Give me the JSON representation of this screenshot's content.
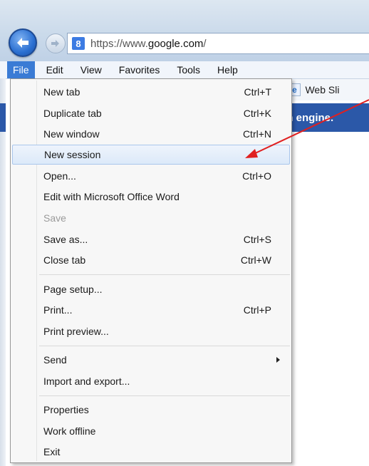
{
  "address_bar": {
    "url_scheme": "https://www.",
    "url_host": "google.com",
    "url_tail": "/",
    "favicon_letter": "8"
  },
  "menubar": [
    "File",
    "Edit",
    "View",
    "Favorites",
    "Tools",
    "Help"
  ],
  "favorites_bar": {
    "partial_text": "er",
    "web_slice": "Web Sli"
  },
  "page_banner": "ch engine.",
  "file_menu": {
    "items": [
      {
        "label": "New tab",
        "shortcut": "Ctrl+T"
      },
      {
        "label": "Duplicate tab",
        "shortcut": "Ctrl+K"
      },
      {
        "label": "New window",
        "shortcut": "Ctrl+N"
      },
      {
        "label": "New session",
        "shortcut": ""
      },
      {
        "label": "Open...",
        "shortcut": "Ctrl+O"
      },
      {
        "label": "Edit with Microsoft Office Word",
        "shortcut": ""
      },
      {
        "label": "Save",
        "shortcut": ""
      },
      {
        "label": "Save as...",
        "shortcut": "Ctrl+S"
      },
      {
        "label": "Close tab",
        "shortcut": "Ctrl+W"
      },
      {
        "label": "Page setup...",
        "shortcut": ""
      },
      {
        "label": "Print...",
        "shortcut": "Ctrl+P"
      },
      {
        "label": "Print preview...",
        "shortcut": ""
      },
      {
        "label": "Send",
        "shortcut": ""
      },
      {
        "label": "Import and export...",
        "shortcut": ""
      },
      {
        "label": "Properties",
        "shortcut": ""
      },
      {
        "label": "Work offline",
        "shortcut": ""
      },
      {
        "label": "Exit",
        "shortcut": ""
      }
    ],
    "highlighted": "New session",
    "disabled": [
      "Save"
    ]
  },
  "colors": {
    "menu_highlight": "#3a7bd5",
    "annotation_arrow": "#e02020",
    "banner": "#2b58a8"
  }
}
